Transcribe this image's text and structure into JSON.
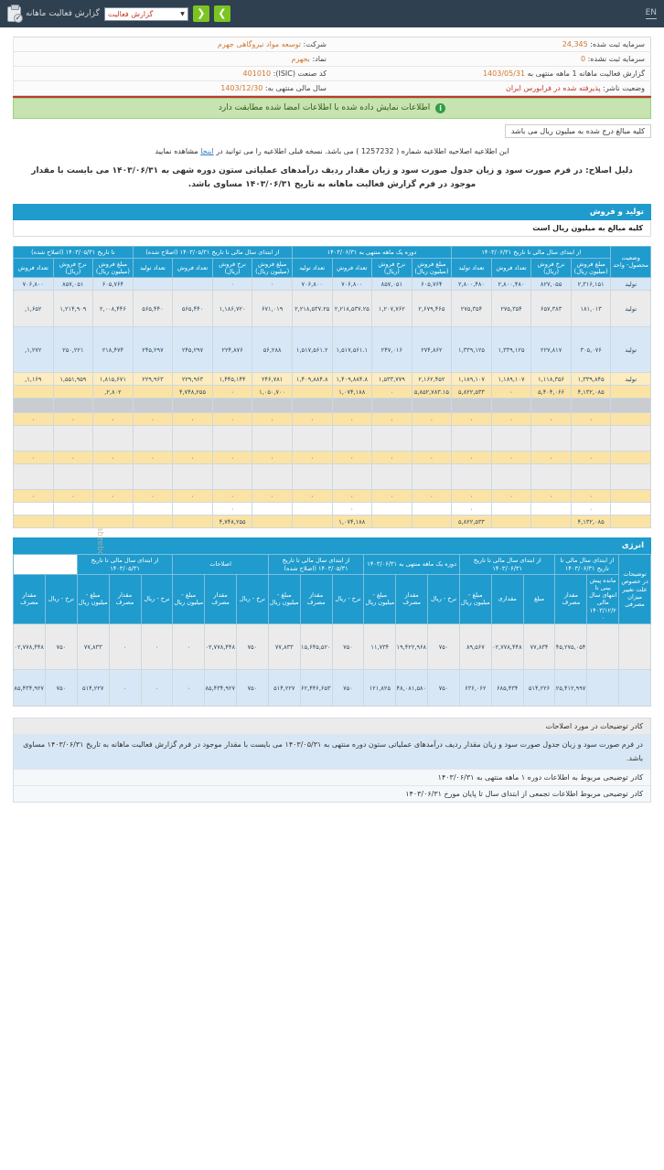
{
  "topbar": {
    "title": "گزارش فعالیت ماهانه",
    "select_value": "گزارش فعالیت",
    "caret": "▼",
    "prev_label": "❯",
    "next_label": "❮",
    "lang": "EN",
    "clipboard_icon": "clipboard-check-icon"
  },
  "info": {
    "company_label": "شرکت:",
    "company_value": "توسعه مواد نیروگاهی جهرم",
    "registered_capital_label": "سرمایه ثبت شده:",
    "registered_capital_value": "24,345",
    "symbol_label": "نماد:",
    "symbol_value": "بجهرم",
    "unregistered_capital_label": "سرمایه ثبت نشده:",
    "unregistered_capital_value": "0",
    "isic_label": "کد صنعت (ISIC):",
    "isic_value": "401010",
    "period_label": "گزارش فعالیت ماهانه  1 ماهه منتهی به",
    "period_value": "1403/05/31",
    "fiscal_year_label": "سال مالی منتهی به:",
    "fiscal_year_value": "1403/12/30",
    "issuer_status_label": "وضعیت ناشر:",
    "issuer_status_value": "پذیرفته شده در فرابورس ایران"
  },
  "notice": {
    "icon": "info-icon",
    "text": "اطلاعات نمایش داده شده با اطلاعات امضا شده مطابقت دارد"
  },
  "unit_note": "کلیه مبالغ درج شده به میلیون ریال می باشد",
  "amendment": {
    "prefix": "این اطلاعیه اصلاحیه اطلاعیه شماره ( 1257232 ) می باشد. نسخه قبلی اطلاعیه را می توانید در",
    "link": "اینجا",
    "suffix": "مشاهده نمایید"
  },
  "reason": "دلیل اصلاح: در فرم صورت سود و زیان جدول صورت سود و زیان مقدار ردیف درآمدهای عملیاتی ستون دوره شهی به ۱۴۰۳/۰۶/۳۱ می بایست با مقدار موجود در فرم گزارش فعالیت ماهانه به تاریخ ۱۴۰۳/۰۶/۳۱ مساوی باشد.",
  "production_section": {
    "title": "تولید و فروش",
    "subtitle": "کلیه مبالغ به میلیون ریال است"
  },
  "production_groups": [
    {
      "label": "از ابتدای سال مالی تا تاریخ ۱۴۰۳/۰۶/۳۱",
      "span": 4
    },
    {
      "label": "دوره یک ماهه منتهی به ۱۴۰۳/۰۶/۳۱",
      "span": 4
    },
    {
      "label": "از ابتدای سال مالی تا تاریخ ۱۴۰۳/۰۵/۳۱ (اصلاح شده)",
      "span": 4
    },
    {
      "label": "تا تاریخ ۱۴۰۳/۰۵/۳۱ (اصلاح شده)",
      "span": 3
    }
  ],
  "production_subheaders": [
    "وضعیت محصول- واحد",
    "مبلغ فروش (میلیون ریال)",
    "نرخ فروش (ریال)",
    "تعداد فروش",
    "تعداد تولید",
    "مبلغ فروش (میلیون ریال)",
    "نرخ فروش (ریال)",
    "تعداد فروش",
    "تعداد تولید",
    "مبلغ فروش (میلیون ریال)",
    "نرخ فروش (ریال)",
    "تعداد فروش",
    "تعداد تولید",
    "مبلغ فروش (میلیون ریال)",
    "نرخ فروش (ریال)",
    "تعداد فروش"
  ],
  "production_rows": [
    {
      "style": "r-blue",
      "unit": "تولید",
      "cells": [
        "۲,۳۱۶,۱۵۱",
        "۸۲۷,۰۵۵",
        "۲,۸۰۰,۴۸۰",
        "۲,۸۰۰,۴۸۰",
        "۶۰۵,۷۶۴",
        "۸۵۷,۰۵۱",
        "۷۰۶,۸۰۰",
        "۷۰۶,۸۰۰",
        "۰",
        "۰",
        "",
        "",
        "۶۰۵,۷۶۴",
        "۸۵۷,۰۵۱",
        "۷۰۶,۸۰۰"
      ]
    },
    {
      "style": "r-grey r-tall",
      "unit": "تولید",
      "cells": [
        "۱۸۱,۰۱۳",
        "۶۵۷,۳۸۳",
        "۲۷۵,۳۵۴",
        "۲۷۵,۳۵۴",
        "۲,۶۷۹,۴۶۵",
        "۱,۲۰۷,۷۶۲",
        "۲,۲۱۸,۵۳۷.۲۵",
        "۲,۲۱۸,۵۳۷.۲۵",
        "۶۷۱,۰۱۹",
        "۱,۱۸۶,۷۲۰",
        "۵۶۵,۴۴۰",
        "۵۶۵,۴۴۰",
        "۲,۰۰۸,۴۴۶",
        "۱,۲۱۴,۹۰۹",
        "۱,۶۵۲,"
      ]
    },
    {
      "style": "r-blue r-tall2",
      "unit": "تولید",
      "cells": [
        "۳۰۵,۰۷۶",
        "۲۲۷,۸۱۷",
        "۱,۳۳۹,۱۲۵",
        "۱,۳۳۹,۱۲۵",
        "۲۷۴,۸۶۲",
        "۲۴۷,۰۱۶",
        "۱,۵۱۷,۵۶۱.۱",
        "۱,۵۱۷,۵۶۱.۲",
        "۵۶,۲۸۸",
        "۲۲۴,۸۷۶",
        "۲۴۵,۲۹۷",
        "۲۴۵,۲۹۷",
        "۲۱۸,۴۷۴",
        "۲۵۰,۲۲۱",
        "۱,۲۷۲,"
      ]
    },
    {
      "style": "r-yellow-lite",
      "unit": "تولید",
      "cells": [
        "۱,۳۳۹,۸۴۵",
        "۱,۱۱۸,۳۵۶",
        "۱,۱۸۹,۱۰۷",
        "۱,۱۸۹,۱۰۷",
        "۲,۱۶۲,۴۵۲",
        "۱,۵۳۳,۷۷۹",
        "۱,۴۰۹,۸۸۴.۸",
        "۱,۴۰۹,۸۸۴.۸",
        "۲۴۶,۷۸۱",
        "۱,۴۴۵,۱۴۴",
        "۲۲۹,۹۶۳",
        "۲۲۹,۹۶۳",
        "۱,۸۱۵,۶۷۱",
        "۱,۵۵۱,۹۵۹",
        "۱,۱۶۹,"
      ]
    },
    {
      "style": "r-yellow",
      "unit": "",
      "cells": [
        "۴,۱۳۲,۰۸۵",
        "۵,۴۰۴,۰۶۶",
        "۰",
        "۵,۸۲۲,۵۳۳",
        "۵,۸۵۲,۷۸۳.۱۵",
        "۰",
        "۱,۰۷۴,۱۸۸",
        "",
        "۱,۰۵۰,۷۰۰",
        "۰",
        "۴,۷۴۸,۲۵۵",
        "",
        "۲,۸۰۲,",
        "",
        " "
      ]
    },
    {
      "style": "r-spacer",
      "unit": "",
      "cells": [
        "",
        "",
        "",
        "",
        "",
        "",
        "",
        "",
        "",
        "",
        "",
        "",
        "",
        "",
        ""
      ]
    },
    {
      "style": "r-yellow",
      "unit": "",
      "cells": [
        "۰",
        "۰",
        "۰",
        "۰",
        "۰",
        "۰",
        "۰",
        "۰",
        "۰",
        "۰",
        "۰",
        "۰",
        "۰",
        "۰",
        "۰"
      ]
    },
    {
      "style": "r-spacer2",
      "unit": "",
      "cells": [
        "",
        "",
        "",
        "",
        "",
        "",
        "",
        "",
        "",
        "",
        "",
        "",
        "",
        "",
        ""
      ]
    },
    {
      "style": "r-yellow",
      "unit": "",
      "cells": [
        "۰",
        "۰",
        "۰",
        "۰",
        "۰",
        "۰",
        "۰",
        "۰",
        "۰",
        "۰",
        "۰",
        "۰",
        "۰",
        "۰",
        "۰"
      ]
    },
    {
      "style": "r-spacer2",
      "unit": "",
      "cells": [
        "",
        "",
        "",
        "",
        "",
        "",
        "",
        "",
        "",
        "",
        "",
        "",
        "",
        "",
        ""
      ]
    },
    {
      "style": "r-yellow",
      "unit": "",
      "cells": [
        "۰",
        "۰",
        "۰",
        "۰",
        "۰",
        "۰",
        "۰",
        "۰",
        "۰",
        "۰",
        "۰",
        "۰",
        "۰",
        "۰",
        "۰"
      ]
    },
    {
      "style": "r-white",
      "unit": "",
      "cells": [
        "۰",
        "",
        "",
        "۰",
        "",
        "",
        "۰",
        "",
        "",
        "۰",
        "",
        "",
        "",
        "",
        ""
      ]
    },
    {
      "style": "r-yellow",
      "unit": "",
      "cells": [
        "۴,۱۳۲,۰۸۵",
        "",
        "",
        "۵,۸۲۲,۵۳۳",
        "",
        "",
        "۱,۰۷۴,۱۸۸",
        "",
        "",
        "۴,۷۴۸,۲۵۵",
        "",
        "",
        "",
        "",
        ""
      ]
    }
  ],
  "energy_section": {
    "title": "انرژی"
  },
  "energy_groups": [
    {
      "label": "از ابتدای سال مالی تا تاریخ ۱۴۰۳/۰۶/۳۱",
      "span": 2
    },
    {
      "label": "از ابتدای سال مالی تا تاریخ ۱۴۰۳/۰۶/۳۱",
      "span": 3
    },
    {
      "label": "دوره یک ماهه منتهی به ۱۴۰۳/۰۶/۳۱",
      "span": 3
    },
    {
      "label": "از ابتدای سال مالی تا تاریخ ۱۴۰۳/۰۵/۳۱ (اصلاح شده)",
      "span": 3
    },
    {
      "label": "اصلاحات",
      "span": 3
    },
    {
      "label": "از ابتدای سال مالی تا تاریخ ۱۴۰۳/۰۵/۳۱",
      "span": 3
    }
  ],
  "energy_subheaders": [
    "توضیحات در خصوص علت تغییر میزان مصرفی",
    "مانده پیش بینی تا انتهای سال مالی ۱۴۰۳/۱۲/۲۰",
    "مقدار مصرف",
    "مبلغ",
    "مقداری",
    "مبلغ - میلیون ریال",
    "نرخ - ریال",
    "مقدار مصرف",
    "مبلغ - میلیون ریال",
    "نرخ - ریال",
    "مقدار مصرف",
    "مبلغ - میلیون ریال",
    "نرخ - ریال",
    "مقدار مصرف",
    "مبلغ - میلیون ریال",
    "نرخ - ریال",
    "مقدار مصرف",
    "مبلغ - میلیون ریال",
    "نرخ - ریال",
    "مقدار مصرف"
  ],
  "energy_rows": [
    {
      "style": "r-grey r-tall2",
      "cells": [
        "",
        "۴۵,۲۷۵,۰۵۴",
        "۷۷,۸۳۴",
        "۱۰۲,۷۷۸,۴۴۸",
        "۸۹,۵۶۷",
        "۷۵۰",
        "۱۱۹,۴۲۲,۹۶۸",
        "۱۱,۷۳۴",
        "۷۵۰",
        "۱۵,۶۴۵,۵۲۰",
        "۷۷,۸۳۳",
        "۷۵۰",
        "۱۰۲,۷۷۸,۴۴۸",
        "۰",
        "۰",
        "۰",
        "۷۷,۸۳۳",
        "۷۵۰",
        "۱۰۲,۷۷۸,۴۴۸",
        ""
      ]
    },
    {
      "style": "r-blue r-tall",
      "cells": [
        "",
        "۸۲۵,۴۱۲,۹۹۷",
        "۵۱۴,۲۲۶",
        "۶۸۵,۴۳۴",
        "۶۳۶,۰۶۲",
        "۷۵۰",
        "۸۴۸,۰۸۱,۵۸۰",
        "۱۲۱,۸۲۵",
        "۷۵۰",
        "۱۶۲,۴۴۶,۶۵۳",
        "۵۱۴,۲۲۷",
        "۷۵۰",
        "۶۸۵,۴۳۴,۹۲۷",
        "۰",
        "۰",
        "۰",
        "۵۱۴,۲۲۷",
        "۷۵۰",
        "۶۸۵,۴۳۴,۹۲۷",
        ""
      ]
    }
  ],
  "watermark": {
    "text_fa": "نبض بورس",
    "text_en": "nabzebourse.com",
    "at_symbol": "@",
    "bull_icon": "bull-logo-icon",
    "side_text": "nabzebourse.ir"
  },
  "notes": {
    "head": "کادر توضیحات در مورد اصلاحات",
    "body": "در فرم صورت سود و زیان جدول صورت سود و زیان مقدار ردیف درآمدهای عملیاتی ستون دوره منتهی به ۱۴۰۳/۰۵/۳۱ می بایست با مقدار موجود در فرم گزارش فعالیت ماهانه به تاریخ ۱۴۰۳/۰۶/۳۱ مساوی باشد.",
    "note2": "کادر توضیحی مربوط به اطلاعات دوره ۱ ماهه منتهی به ۱۴۰۳/۰۶/۳۱",
    "note3": "کادر توضیحی مربوط اطلاعات تجمعی از ابتدای سال تا پایان مورخ ۱۴۰۳/۰۶/۳۱"
  }
}
